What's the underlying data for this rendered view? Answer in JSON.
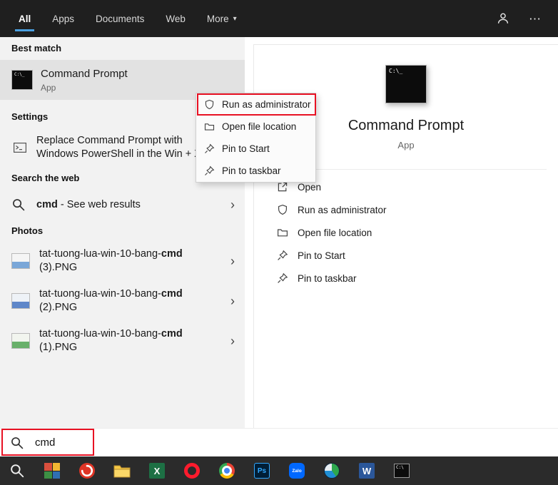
{
  "colors": {
    "accent_blue": "#4a9fe0",
    "annotation_red": "#e81123",
    "topbar_bg": "#1f1f1f",
    "taskbar_bg": "#2b2b2b",
    "panel_bg": "#f2f2f2"
  },
  "ui": {
    "chevron_glyph": "›",
    "caret_glyph": "▾",
    "ellipsis_glyph": "⋯"
  },
  "topbar": {
    "tabs": [
      {
        "label": "All",
        "selected": true
      },
      {
        "label": "Apps",
        "selected": false
      },
      {
        "label": "Documents",
        "selected": false
      },
      {
        "label": "Web",
        "selected": false
      },
      {
        "label": "More",
        "selected": false
      }
    ]
  },
  "left": {
    "best_match_header": "Best match",
    "best_match": {
      "title": "Command Prompt",
      "subtitle": "App",
      "icon_glyph": "C:\\_"
    },
    "settings_header": "Settings",
    "settings_item": {
      "line1": "Replace Command Prompt with",
      "line2": "Windows PowerShell in the Win + X"
    },
    "web_header": "Search the web",
    "web_item": {
      "query": "cmd",
      "rest": " - See web results"
    },
    "photos_header": "Photos",
    "photos": [
      {
        "prefix": "tat-tuong-lua-win-10-bang-",
        "bold": "cmd",
        "line2": "(3).PNG"
      },
      {
        "prefix": "tat-tuong-lua-win-10-bang-",
        "bold": "cmd",
        "line2": "(2).PNG"
      },
      {
        "prefix": "tat-tuong-lua-win-10-bang-",
        "bold": "cmd",
        "line2": "(1).PNG"
      }
    ]
  },
  "context_menu": {
    "items": [
      {
        "label": "Run as administrator"
      },
      {
        "label": "Open file location"
      },
      {
        "label": "Pin to Start"
      },
      {
        "label": "Pin to taskbar"
      }
    ]
  },
  "preview": {
    "title": "Command Prompt",
    "subtitle": "App",
    "icon_glyph": "C:\\_",
    "actions": [
      {
        "label": "Open"
      },
      {
        "label": "Run as administrator"
      },
      {
        "label": "Open file location"
      },
      {
        "label": "Pin to Start"
      },
      {
        "label": "Pin to taskbar"
      }
    ]
  },
  "search_bar": {
    "value": "cmd"
  },
  "taskbar": {
    "apps": [
      {
        "name": "search"
      },
      {
        "name": "photo-grid"
      },
      {
        "name": "red-swirl-app"
      },
      {
        "name": "file-explorer"
      },
      {
        "name": "excel",
        "glyph": "X"
      },
      {
        "name": "opera"
      },
      {
        "name": "chrome"
      },
      {
        "name": "photoshop",
        "glyph": "Ps"
      },
      {
        "name": "zalo",
        "glyph": "Zalo"
      },
      {
        "name": "globe-browser"
      },
      {
        "name": "word",
        "glyph": "W"
      },
      {
        "name": "cmd",
        "glyph": "C:\\"
      }
    ]
  }
}
